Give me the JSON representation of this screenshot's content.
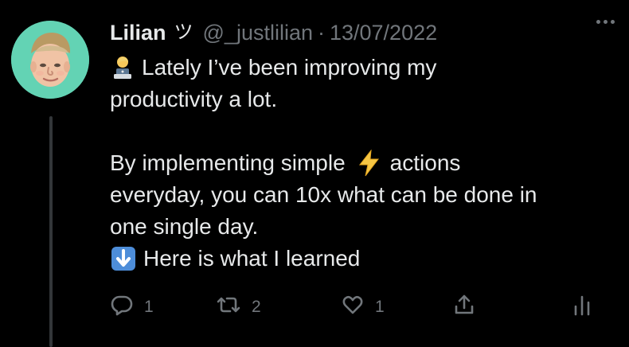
{
  "tweet": {
    "author": {
      "display_name": "Lilian",
      "name_emoji": "ツ",
      "handle": "@_justlilian",
      "separator": "·",
      "date": "13/07/2022"
    },
    "lines": [
      {
        "emoji": "technologist",
        "text": "Lately I’ve been improving my"
      },
      {
        "text": "productivity a lot."
      },
      {
        "text": ""
      },
      {
        "parts": [
          "By implementing simple",
          "actions"
        ],
        "emoji": "lightning"
      },
      {
        "text": "everyday, you can 10x what can be done in"
      },
      {
        "text": "one single day."
      },
      {
        "emoji": "down-arrow",
        "text": "Here is what I learned"
      }
    ],
    "actions": {
      "reply_count": "1",
      "retweet_count": "2",
      "like_count": "1"
    }
  },
  "colors": {
    "background": "#000000",
    "primary_text": "#e7e9ea",
    "secondary_text": "#71767b",
    "avatar_background": "#63d3b4",
    "thread_line": "#333639"
  },
  "icons": {
    "more": "more-icon",
    "reply": "reply-icon",
    "retweet": "retweet-icon",
    "like": "like-icon",
    "share": "share-icon",
    "analytics": "analytics-icon"
  }
}
